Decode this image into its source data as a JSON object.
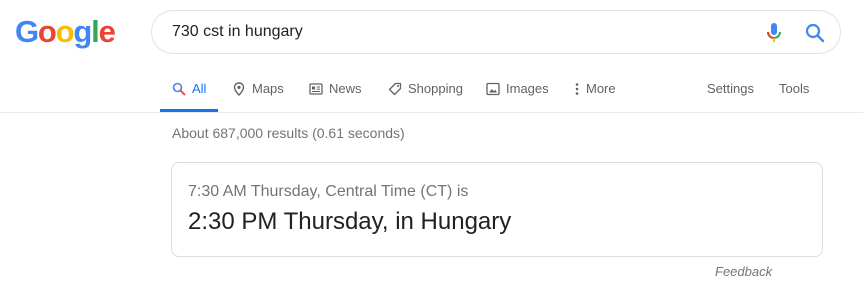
{
  "logo": {
    "letters": [
      "G",
      "o",
      "o",
      "g",
      "l",
      "e"
    ],
    "colors": [
      "#4285F4",
      "#EA4335",
      "#FBBC05",
      "#4285F4",
      "#34A853",
      "#EA4335"
    ]
  },
  "search": {
    "query": "730 cst in hungary",
    "mic_icon": "mic-icon",
    "search_icon": "search-icon"
  },
  "tabs": [
    {
      "label": "All",
      "icon": "search-icon",
      "active": true
    },
    {
      "label": "Maps",
      "icon": "map-pin-icon",
      "active": false
    },
    {
      "label": "News",
      "icon": "newspaper-icon",
      "active": false
    },
    {
      "label": "Shopping",
      "icon": "tag-icon",
      "active": false
    },
    {
      "label": "Images",
      "icon": "image-icon",
      "active": false
    },
    {
      "label": "More",
      "icon": "more-vert-icon",
      "active": false
    }
  ],
  "tools": {
    "settings_label": "Settings",
    "tools_label": "Tools"
  },
  "result_stats": "About 687,000 results (0.61 seconds)",
  "answer_card": {
    "source_time": "7:30 AM Thursday, Central Time (CT) is",
    "converted_time": "2:30 PM Thursday, in Hungary"
  },
  "feedback_label": "Feedback",
  "colors": {
    "accent": "#1a73e8",
    "text_secondary": "#70757a"
  }
}
